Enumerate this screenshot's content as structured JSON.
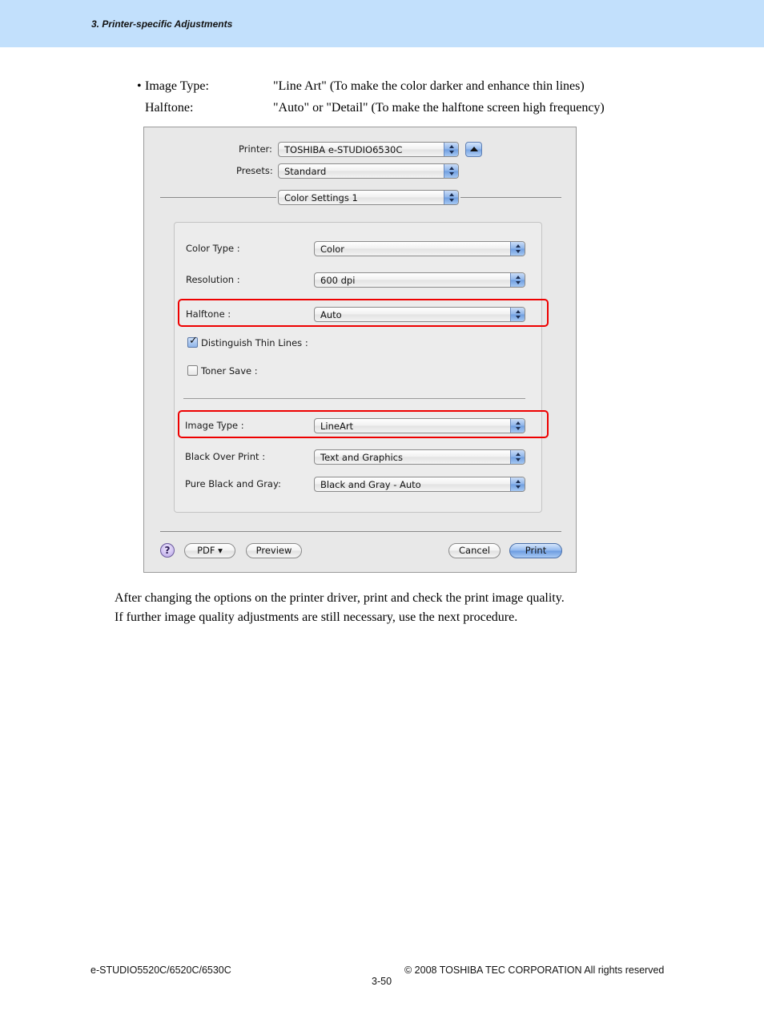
{
  "header": {
    "section_title": "3. Printer-specific Adjustments",
    "band_color": "#c2e0fc"
  },
  "intro": [
    {
      "bullet": "•",
      "label": "Image Type:",
      "value": "\"Line Art\" (To make the color darker and enhance thin lines)"
    },
    {
      "bullet": "",
      "label": "Halftone:",
      "value": "\"Auto\" or \"Detail\" (To make the halftone screen high frequency)"
    }
  ],
  "dialog": {
    "printer": {
      "label": "Printer:",
      "value": "TOSHIBA e-STUDIO6530C"
    },
    "presets": {
      "label": "Presets:",
      "value": "Standard"
    },
    "panel": {
      "value": "Color Settings 1"
    },
    "settings": {
      "color_type": {
        "label": "Color Type :",
        "value": "Color"
      },
      "resolution": {
        "label": "Resolution :",
        "value": "600 dpi"
      },
      "halftone": {
        "label": "Halftone :",
        "value": "Auto"
      },
      "distinguish_thin_lines": {
        "label": "Distinguish Thin Lines :",
        "checked": true
      },
      "toner_save": {
        "label": "Toner Save :",
        "checked": false
      },
      "image_type": {
        "label": "Image Type :",
        "value": "LineArt"
      },
      "black_over_print": {
        "label": "Black Over Print :",
        "value": "Text and Graphics"
      },
      "pure_black_gray": {
        "label": "Pure Black and Gray:",
        "value": "Black and Gray - Auto"
      }
    },
    "buttons": {
      "help": "?",
      "pdf": "PDF ▾",
      "preview": "Preview",
      "cancel": "Cancel",
      "print": "Print"
    },
    "highlight_color": "#ee0000"
  },
  "body_text": [
    "After changing the options on the printer driver, print and check the print image quality.",
    "If further image quality adjustments are still necessary, use the next procedure."
  ],
  "footer": {
    "model": "e-STUDIO5520C/6520C/6530C",
    "copyright": "© 2008 TOSHIBA TEC CORPORATION All rights reserved",
    "page": "3-50"
  }
}
